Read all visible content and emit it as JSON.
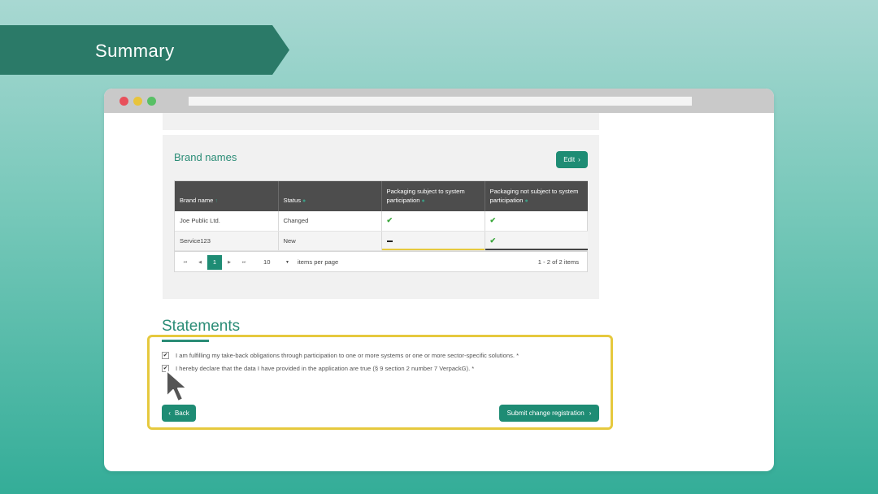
{
  "banner": {
    "title": "Summary"
  },
  "brand_panel": {
    "title": "Brand names",
    "edit_label": "Edit",
    "edit_chevron": "›",
    "columns": [
      "Brand name",
      "Status",
      "Packaging subject to system participation",
      "Packaging not subject to system participation"
    ],
    "rows": [
      {
        "brand": "Joe Public Ltd.",
        "status": "Changed",
        "subject": "check",
        "not_subject": "check"
      },
      {
        "brand": "Service123",
        "status": "New",
        "subject": "dash",
        "not_subject": "check"
      }
    ],
    "pager": {
      "first": "⏮",
      "prev": "◀",
      "current_page": "1",
      "next": "▶",
      "last": "⏭",
      "page_size": "10",
      "page_size_caret": "▼",
      "items_per_page_label": "items per page",
      "info": "1 - 2 of 2 items"
    }
  },
  "statements": {
    "title": "Statements",
    "items": [
      {
        "text": "I am fulfilling my take-back obligations through participation to one or more systems or one or more sector-specific solutions. *",
        "checked": true
      },
      {
        "text": "I hereby declare that the data I have provided in the application are true (§ 9 section 2 number 7 VerpackG). *",
        "checked": true
      }
    ]
  },
  "actions": {
    "back_label": "Back",
    "back_chevron": "‹",
    "submit_label": "Submit change registration",
    "submit_chevron": "›"
  },
  "colors": {
    "accent": "#1e8c74",
    "banner": "#2b7a68",
    "highlight": "#e6c93e",
    "table_header": "#4d4d4d"
  },
  "icons": {
    "check": "✔",
    "checkbox_check": "✔",
    "sort": "●"
  }
}
